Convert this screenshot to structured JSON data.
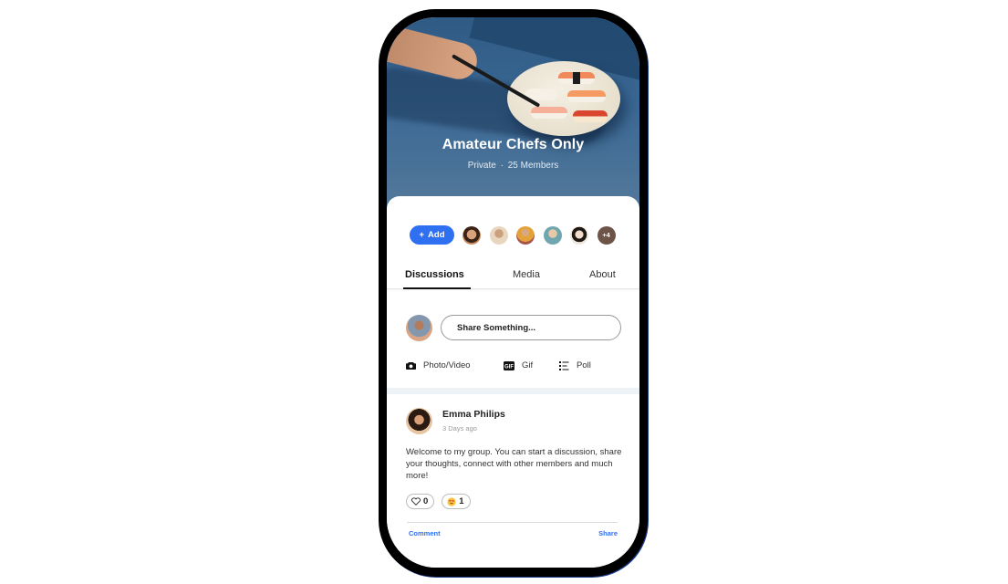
{
  "group": {
    "title": "Amateur Chefs Only",
    "privacy": "Private",
    "separator": "·",
    "member_count": "25 Members"
  },
  "members": {
    "add_label": "Add",
    "add_icon": "plus-icon",
    "avatars": [
      "member-1",
      "member-2",
      "member-3",
      "member-4",
      "member-5"
    ],
    "overflow_label": "+4"
  },
  "tabs": [
    {
      "label": "Discussions",
      "active": true
    },
    {
      "label": "Media",
      "active": false
    },
    {
      "label": "About",
      "active": false
    }
  ],
  "composer": {
    "placeholder": "Share Something...",
    "actions": [
      {
        "label": "Photo/Video",
        "icon": "camera-icon"
      },
      {
        "label": "Gif",
        "icon": "gif-icon"
      },
      {
        "label": "Poll",
        "icon": "poll-icon"
      }
    ]
  },
  "post": {
    "author": "Emma Philips",
    "time": "3 Days ago",
    "body": "Welcome to my group. You can start a discussion, share your thoughts, connect with other members and much more!",
    "reactions": [
      {
        "icon": "heart-icon",
        "count": "0"
      },
      {
        "icon": "heart-eyes-emoji-icon",
        "count": "1"
      }
    ],
    "comment_label": "Comment",
    "share_label": "Share"
  },
  "colors": {
    "accent": "#2f6ff2",
    "hero_bg": "#3a6894",
    "frame": "#000000"
  }
}
